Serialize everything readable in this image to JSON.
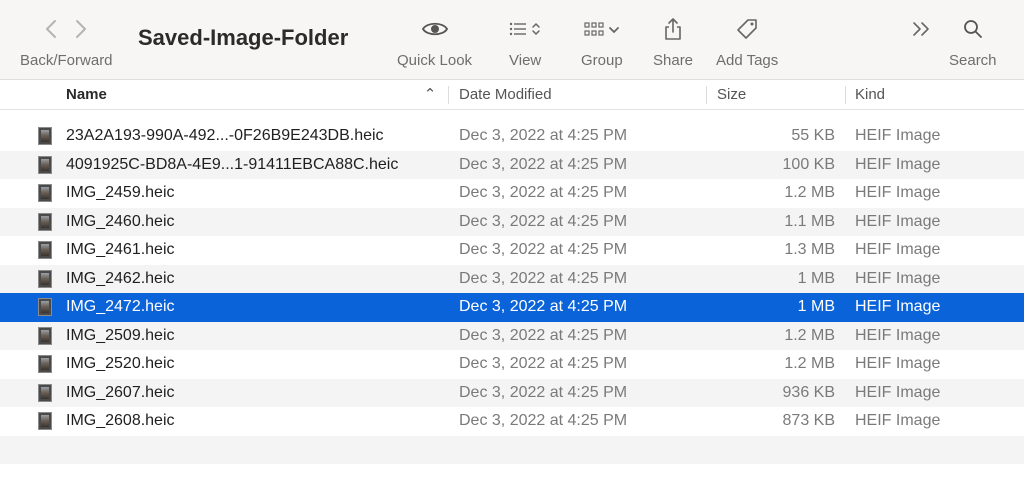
{
  "window": {
    "title": "Saved-Image-Folder"
  },
  "toolbar": {
    "back_forward_label": "Back/Forward",
    "quick_look_label": "Quick Look",
    "view_label": "View",
    "group_label": "Group",
    "share_label": "Share",
    "add_tags_label": "Add Tags",
    "search_label": "Search",
    "icons": [
      "chevron-left-icon",
      "chevron-right-icon",
      "eye-icon",
      "list-icon",
      "up-down-chevron-icon",
      "grid-icon",
      "chevron-down-icon",
      "share-icon",
      "tag-icon",
      "double-chevron-right-icon",
      "search-icon"
    ]
  },
  "columns": {
    "name": "Name",
    "date_modified": "Date Modified",
    "size": "Size",
    "kind": "Kind",
    "sort_indicator": "⌃"
  },
  "colors": {
    "selection": "#0a63d9",
    "toolbar_bg": "#f7f6f4",
    "alt_row": "#f4f4f4"
  },
  "files": [
    {
      "name": "23A2A193-990A-492...-0F26B9E243DB.heic",
      "date": "Dec 3, 2022 at 4:25 PM",
      "size": "55 KB",
      "kind": "HEIF Image",
      "selected": false
    },
    {
      "name": "4091925C-BD8A-4E9...1-91411EBCA88C.heic",
      "date": "Dec 3, 2022 at 4:25 PM",
      "size": "100 KB",
      "kind": "HEIF Image",
      "selected": false
    },
    {
      "name": "IMG_2459.heic",
      "date": "Dec 3, 2022 at 4:25 PM",
      "size": "1.2 MB",
      "kind": "HEIF Image",
      "selected": false
    },
    {
      "name": "IMG_2460.heic",
      "date": "Dec 3, 2022 at 4:25 PM",
      "size": "1.1 MB",
      "kind": "HEIF Image",
      "selected": false
    },
    {
      "name": "IMG_2461.heic",
      "date": "Dec 3, 2022 at 4:25 PM",
      "size": "1.3 MB",
      "kind": "HEIF Image",
      "selected": false
    },
    {
      "name": "IMG_2462.heic",
      "date": "Dec 3, 2022 at 4:25 PM",
      "size": "1 MB",
      "kind": "HEIF Image",
      "selected": false
    },
    {
      "name": "IMG_2472.heic",
      "date": "Dec 3, 2022 at 4:25 PM",
      "size": "1 MB",
      "kind": "HEIF Image",
      "selected": true
    },
    {
      "name": "IMG_2509.heic",
      "date": "Dec 3, 2022 at 4:25 PM",
      "size": "1.2 MB",
      "kind": "HEIF Image",
      "selected": false
    },
    {
      "name": "IMG_2520.heic",
      "date": "Dec 3, 2022 at 4:25 PM",
      "size": "1.2 MB",
      "kind": "HEIF Image",
      "selected": false
    },
    {
      "name": "IMG_2607.heic",
      "date": "Dec 3, 2022 at 4:25 PM",
      "size": "936 KB",
      "kind": "HEIF Image",
      "selected": false
    },
    {
      "name": "IMG_2608.heic",
      "date": "Dec 3, 2022 at 4:25 PM",
      "size": "873 KB",
      "kind": "HEIF Image",
      "selected": false
    }
  ]
}
